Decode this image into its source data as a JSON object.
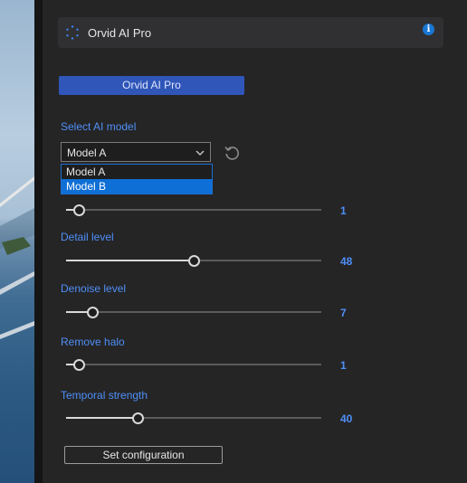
{
  "header": {
    "title": "Orvid AI Pro",
    "logo_icon": "hexagon-dots-icon",
    "info_icon": "info-icon"
  },
  "pro_button": {
    "label": "Orvid AI Pro"
  },
  "model": {
    "label": "Select AI model",
    "selected": "Model A",
    "options": [
      "Model A",
      "Model B"
    ],
    "highlighted": "Model B"
  },
  "sliders": [
    {
      "label": "",
      "value": "1",
      "fraction": 0.03
    },
    {
      "label": "Detail level",
      "value": "48",
      "fraction": 0.48
    },
    {
      "label": "Denoise level",
      "value": "7",
      "fraction": 0.08
    },
    {
      "label": "Remove halo",
      "value": "1",
      "fraction": 0.03
    },
    {
      "label": "Temporal strength",
      "value": "40",
      "fraction": 0.26
    }
  ],
  "set_button": {
    "label": "Set configuration"
  },
  "colors": {
    "accent": "#4f8ff7",
    "button": "#2f56b8",
    "selection": "#0e6fd6"
  }
}
